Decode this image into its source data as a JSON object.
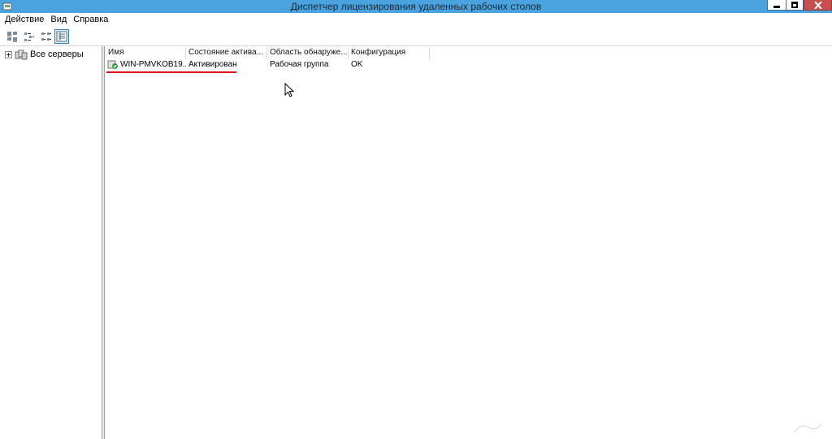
{
  "window": {
    "title": "Диспетчер лицензирования удаленных рабочих столов",
    "title_bar_color": "#4aa3df",
    "close_button_color": "#c74f4f"
  },
  "menu": {
    "items": [
      {
        "label": "Действие"
      },
      {
        "label": "Вид"
      },
      {
        "label": "Справка"
      }
    ]
  },
  "toolbar": {
    "buttons": [
      {
        "icon": "large-icons-view-icon"
      },
      {
        "icon": "small-icons-view-icon"
      },
      {
        "icon": "list-view-icon"
      },
      {
        "icon": "details-view-icon",
        "active": true
      }
    ]
  },
  "tree": {
    "items": [
      {
        "label": "Все серверы",
        "icon": "servers-icon",
        "expanded": false
      }
    ]
  },
  "list": {
    "columns": [
      "Имя",
      "Состояние актива...",
      "Область обнаруже...",
      "Конфигурация"
    ],
    "rows": [
      {
        "name": "WIN-PMVKOB19...",
        "status": "Активирован",
        "scope": "Рабочая группа",
        "config": "OK",
        "icon": "activated-server-icon"
      }
    ],
    "highlight_color": "#e0101a"
  }
}
